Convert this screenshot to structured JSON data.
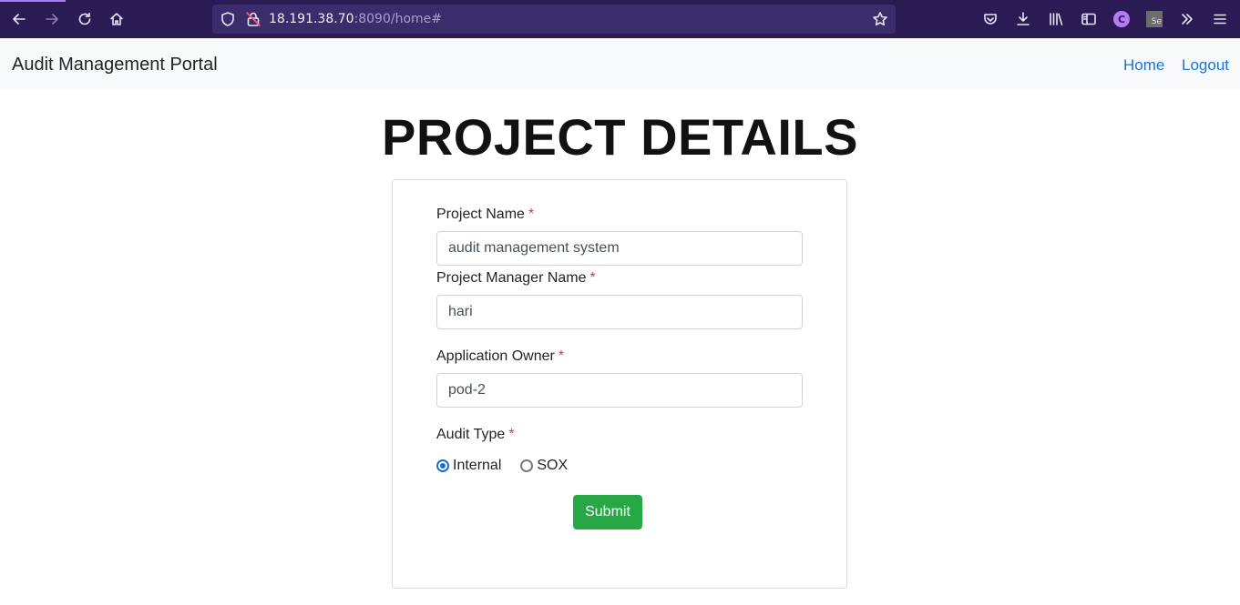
{
  "browser": {
    "url_host": "18.191.38.70",
    "url_rest": ":8090/home#",
    "profile_initial": "C",
    "extension_label": "Se"
  },
  "navbar": {
    "brand": "Audit Management Portal",
    "links": [
      "Home",
      "Logout"
    ]
  },
  "page": {
    "title": "PROJECT DETAILS"
  },
  "form": {
    "required_mark": "*",
    "project_name": {
      "label": "Project Name",
      "value": "audit management system"
    },
    "project_manager_name": {
      "label": "Project Manager Name",
      "value": "hari"
    },
    "application_owner": {
      "label": "Application Owner",
      "value": "pod-2"
    },
    "audit_type": {
      "label": "Audit Type",
      "options": [
        "Internal",
        "SOX"
      ],
      "selected": "Internal"
    },
    "submit_label": "Submit"
  },
  "colors": {
    "browser_toolbar": "#2b1b55",
    "link": "#1a74d2",
    "required": "#dc3545",
    "submit": "#28a745"
  }
}
